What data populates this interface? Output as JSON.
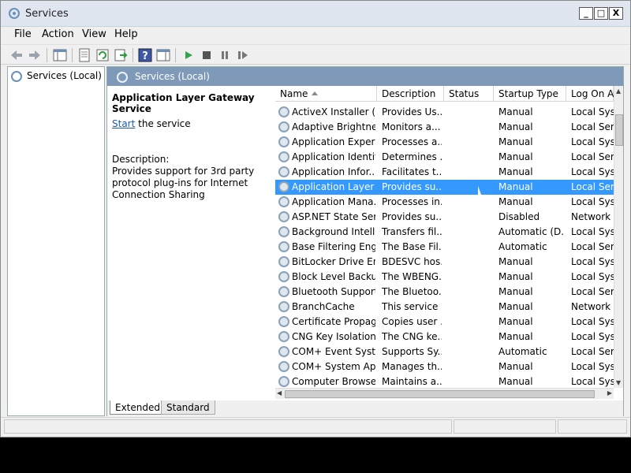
{
  "window": {
    "title": "Services",
    "minimize": "_",
    "maximize": "□",
    "close": "X"
  },
  "menu": [
    "File",
    "Action",
    "View",
    "Help"
  ],
  "tree": {
    "root_label": "Services (Local)"
  },
  "panel_header": "Services (Local)",
  "details": {
    "service_name": "Application Layer Gateway Service",
    "start_link": "Start",
    "start_suffix": " the service",
    "description_label": "Description:",
    "description": "Provides support for 3rd party protocol plug-ins for Internet Connection Sharing"
  },
  "columns": {
    "name": "Name",
    "description": "Description",
    "status": "Status",
    "startup_type": "Startup Type",
    "log_on_as": "Log On A"
  },
  "services": [
    {
      "name": "ActiveX Installer (...",
      "description": "Provides Us...",
      "status": "",
      "startup": "Manual",
      "logon": "Local Syst"
    },
    {
      "name": "Adaptive Brightness",
      "description": "Monitors a...",
      "status": "",
      "startup": "Manual",
      "logon": "Local Serv"
    },
    {
      "name": "Application Experi...",
      "description": "Processes a...",
      "status": "",
      "startup": "Manual",
      "logon": "Local Syst"
    },
    {
      "name": "Application Identity",
      "description": "Determines ...",
      "status": "",
      "startup": "Manual",
      "logon": "Local Serv"
    },
    {
      "name": "Application Infor...",
      "description": "Facilitates t...",
      "status": "",
      "startup": "Manual",
      "logon": "Local Syst"
    },
    {
      "name": "Application Layer ...",
      "description": "Provides su...",
      "status": "",
      "startup": "Manual",
      "logon": "Local Serv",
      "selected": true
    },
    {
      "name": "Application Mana...",
      "description": "Processes in...",
      "status": "",
      "startup": "Manual",
      "logon": "Local Syst"
    },
    {
      "name": "ASP.NET State Ser...",
      "description": "Provides su...",
      "status": "",
      "startup": "Disabled",
      "logon": "Network S"
    },
    {
      "name": "Background Intelli...",
      "description": "Transfers fil...",
      "status": "",
      "startup": "Automatic (D...",
      "logon": "Local Syst"
    },
    {
      "name": "Base Filtering Engi...",
      "description": "The Base Fil...",
      "status": "",
      "startup": "Automatic",
      "logon": "Local Serv"
    },
    {
      "name": "BitLocker Drive En...",
      "description": "BDESVC hos...",
      "status": "",
      "startup": "Manual",
      "logon": "Local Syst"
    },
    {
      "name": "Block Level Backu...",
      "description": "The WBENG...",
      "status": "",
      "startup": "Manual",
      "logon": "Local Syst"
    },
    {
      "name": "Bluetooth Support...",
      "description": "The Bluetoo...",
      "status": "",
      "startup": "Manual",
      "logon": "Local Serv"
    },
    {
      "name": "BranchCache",
      "description": "This service ...",
      "status": "",
      "startup": "Manual",
      "logon": "Network S"
    },
    {
      "name": "Certificate Propag...",
      "description": "Copies user ...",
      "status": "",
      "startup": "Manual",
      "logon": "Local Syst"
    },
    {
      "name": "CNG Key Isolation",
      "description": "The CNG ke...",
      "status": "",
      "startup": "Manual",
      "logon": "Local Syst"
    },
    {
      "name": "COM+ Event Syst...",
      "description": "Supports Sy...",
      "status": "",
      "startup": "Automatic",
      "logon": "Local Serv"
    },
    {
      "name": "COM+ System Ap...",
      "description": "Manages th...",
      "status": "",
      "startup": "Manual",
      "logon": "Local Syst"
    },
    {
      "name": "Computer Browser",
      "description": "Maintains a...",
      "status": "",
      "startup": "Manual",
      "logon": "Local Syst"
    }
  ],
  "tabs": {
    "extended": "Extended",
    "standard": "Standard"
  },
  "colors": {
    "selection": "#3399ff",
    "header_bar": "#7f9ab8",
    "link": "#1c5bb1"
  }
}
